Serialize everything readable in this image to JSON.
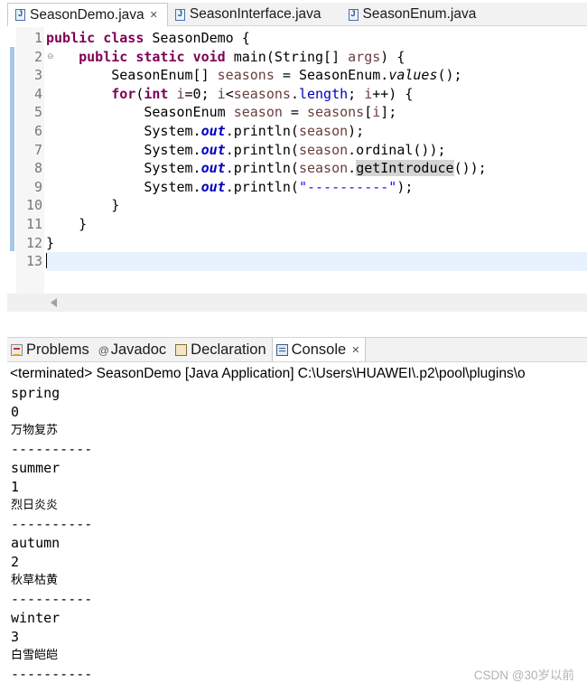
{
  "editor_tabs": [
    {
      "label": "SeasonDemo.java",
      "close": "✕",
      "active": true
    },
    {
      "label": "SeasonInterface.java",
      "active": false
    },
    {
      "label": "SeasonEnum.java",
      "active": false
    }
  ],
  "code": {
    "line_numbers": [
      "1",
      "2",
      "3",
      "4",
      "5",
      "6",
      "7",
      "8",
      "9",
      "10",
      "11",
      "12",
      "13"
    ],
    "fold_marker": "⊖",
    "line1": {
      "kw1": "public",
      "kw2": "class",
      "rest": " SeasonDemo {"
    },
    "line2": {
      "kw1": "public",
      "kw2": "static",
      "kw3": "void",
      "rest": " main(String[] ",
      "param": "args",
      "end": ") {"
    },
    "line3": {
      "t1": "SeasonEnum[] ",
      "var": "seasons",
      "t2": " = SeasonEnum.",
      "method": "values",
      "t3": "();"
    },
    "line4": {
      "kw": "for",
      "t1": "(",
      "kw2": "int",
      "t2": " ",
      "var1": "i",
      "t3": "=0; ",
      "var2": "i",
      "t4": "<",
      "var3": "seasons",
      "t5": ".",
      "fieldname": "length",
      "t6": "; ",
      "var4": "i",
      "t7": "++) {"
    },
    "line5": {
      "t1": "SeasonEnum ",
      "var": "season",
      "t2": " = ",
      "var2": "seasons",
      "t3": "[",
      "var3": "i",
      "t4": "];"
    },
    "line6": {
      "t1": "System.",
      "field": "out",
      "t2": ".println(",
      "var": "season",
      "t3": ");"
    },
    "line7": {
      "t1": "System.",
      "field": "out",
      "t2": ".println(",
      "var": "season",
      "t3": ".ordinal());"
    },
    "line8": {
      "t1": "System.",
      "field": "out",
      "t2": ".println(",
      "var": "season",
      "t3": ".",
      "method": "getIntroduce",
      "t4": "());"
    },
    "line9": {
      "t1": "System.",
      "field": "out",
      "t2": ".println(",
      "str": "\"----------\"",
      "t3": ");"
    },
    "line10": {
      "t": "}"
    },
    "line11": {
      "t": "}"
    },
    "line12": {
      "t": "}"
    }
  },
  "panel_tabs": [
    {
      "label": "Problems",
      "icon": "problems-icon"
    },
    {
      "label": "Javadoc",
      "prefix": "@",
      "icon": "javadoc-icon"
    },
    {
      "label": "Declaration",
      "icon": "declaration-icon"
    },
    {
      "label": "Console",
      "close": "✕",
      "icon": "console-icon",
      "active": true
    }
  ],
  "console": {
    "header": "<terminated> SeasonDemo [Java Application] C:\\Users\\HUAWEI\\.p2\\pool\\plugins\\o",
    "lines": [
      "spring",
      "0",
      "万物复苏",
      "----------",
      "summer",
      "1",
      "烈日炎炎",
      "----------",
      "autumn",
      "2",
      "秋草枯黄",
      "----------",
      "winter",
      "3",
      "白雪皑皑",
      "----------"
    ]
  },
  "watermark": "CSDN @30岁以前"
}
